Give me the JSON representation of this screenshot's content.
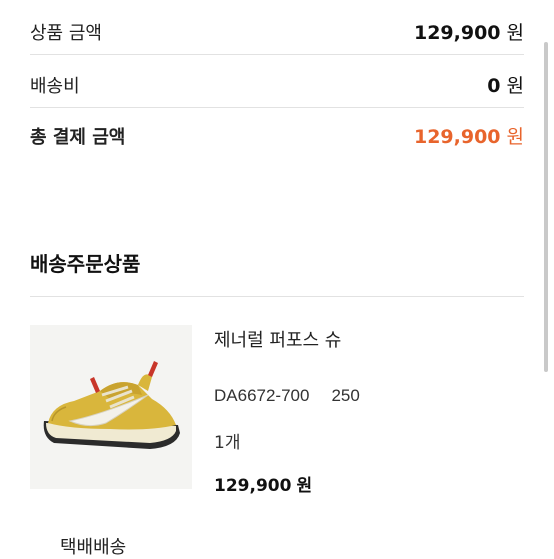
{
  "summary": {
    "product_amount_label": "상품 금액",
    "product_amount_value": "129,900",
    "product_amount_unit": "원",
    "shipping_label": "배송비",
    "shipping_value": "0",
    "shipping_unit": "원",
    "total_label": "총 결제 금액",
    "total_value": "129,900",
    "total_unit": "원"
  },
  "section": {
    "title": "배송주문상품"
  },
  "product": {
    "name": "제너럴 퍼포스 슈",
    "code": "DA6672-700",
    "size": "250",
    "quantity": "1개",
    "price": "129,900",
    "price_unit": "원",
    "image_icon": "sneaker-image"
  },
  "delivery": {
    "method": "택배배송"
  },
  "colors": {
    "accent_total": "#e8642c",
    "shoe_yellow": "#d9b63c"
  }
}
